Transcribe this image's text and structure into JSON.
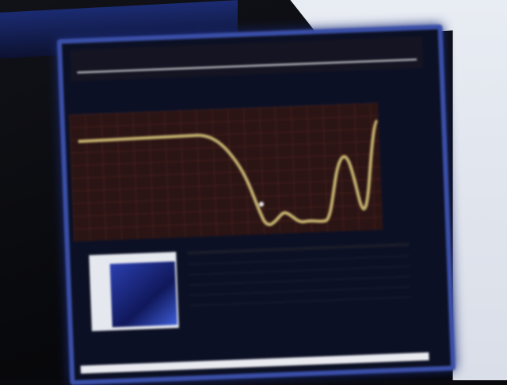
{
  "screen": {
    "header_label": "",
    "scope": {
      "grid_color": "#7c3a2a",
      "trace_color": "#d7c57a",
      "background_color": "#2b1414"
    },
    "table": {
      "columns": [
        "",
        "",
        "",
        ""
      ],
      "rows": [
        [
          "",
          "",
          "",
          ""
        ],
        [
          "",
          "",
          "",
          ""
        ],
        [
          "",
          "",
          "",
          ""
        ],
        [
          "",
          "",
          "",
          ""
        ],
        [
          "",
          "",
          "",
          ""
        ]
      ]
    }
  }
}
